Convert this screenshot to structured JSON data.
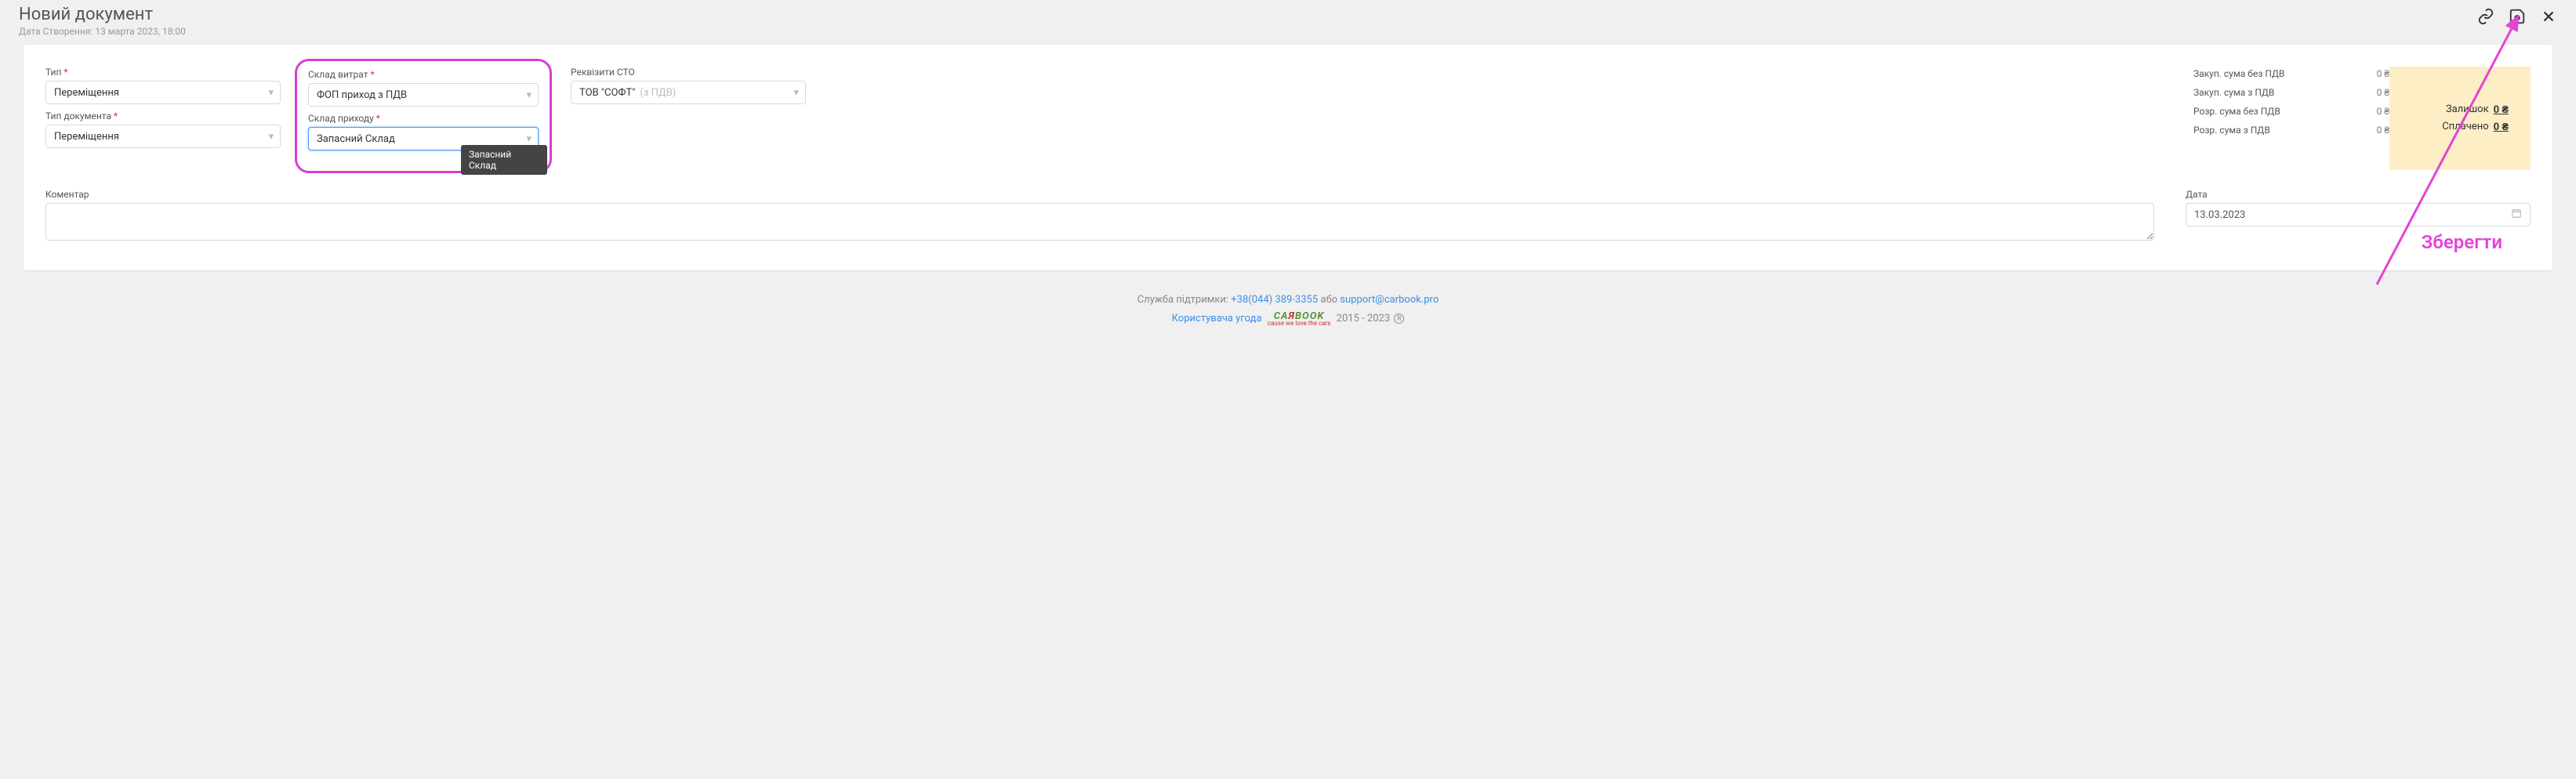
{
  "header": {
    "title": "Новий документ",
    "date_label": "Дата Створення:",
    "date_value": "13 марта 2023, 18:00"
  },
  "form": {
    "type": {
      "label": "Тип",
      "value": "Переміщення"
    },
    "doc_type": {
      "label": "Тип документа",
      "value": "Переміщення"
    },
    "expense_wh": {
      "label": "Склад витрат",
      "value": "ФОП приход з ПДВ"
    },
    "income_wh": {
      "label": "Склад приходу",
      "value": "Запасний Склад"
    },
    "requisites": {
      "label": "Реквізити СТО",
      "value": "ТОВ \"СОФТ\"",
      "hint": "(з ПДВ)"
    },
    "tooltip": "Запасний Склад",
    "comment": {
      "label": "Коментар"
    },
    "date": {
      "label": "Дата",
      "value": "13.03.2023"
    }
  },
  "summary": {
    "rows": [
      {
        "label": "Закуп. сума без ПДВ",
        "value": "0 ₴"
      },
      {
        "label": "Закуп. сума з ПДВ",
        "value": "0 ₴"
      },
      {
        "label": "Розр. сума без ПДВ",
        "value": "0 ₴"
      },
      {
        "label": "Розр. сума з ПДВ",
        "value": "0 ₴"
      }
    ],
    "remain": {
      "label": "Залишок",
      "value": "0 ₴"
    },
    "paid": {
      "label": "Сплачено",
      "value": "0 ₴"
    }
  },
  "annotation": "Зберегти",
  "footer": {
    "support": "Служба підтримки:",
    "phone": "+38(044) 389-3355",
    "or": "або",
    "email": "support@carbook.pro",
    "agreement": "Користувача угода",
    "years": "2015 - 2023",
    "logo_a": "CA",
    "logo_r": "Я",
    "logo_b": "BOOK",
    "logo_sub": "cause we love the cars"
  }
}
